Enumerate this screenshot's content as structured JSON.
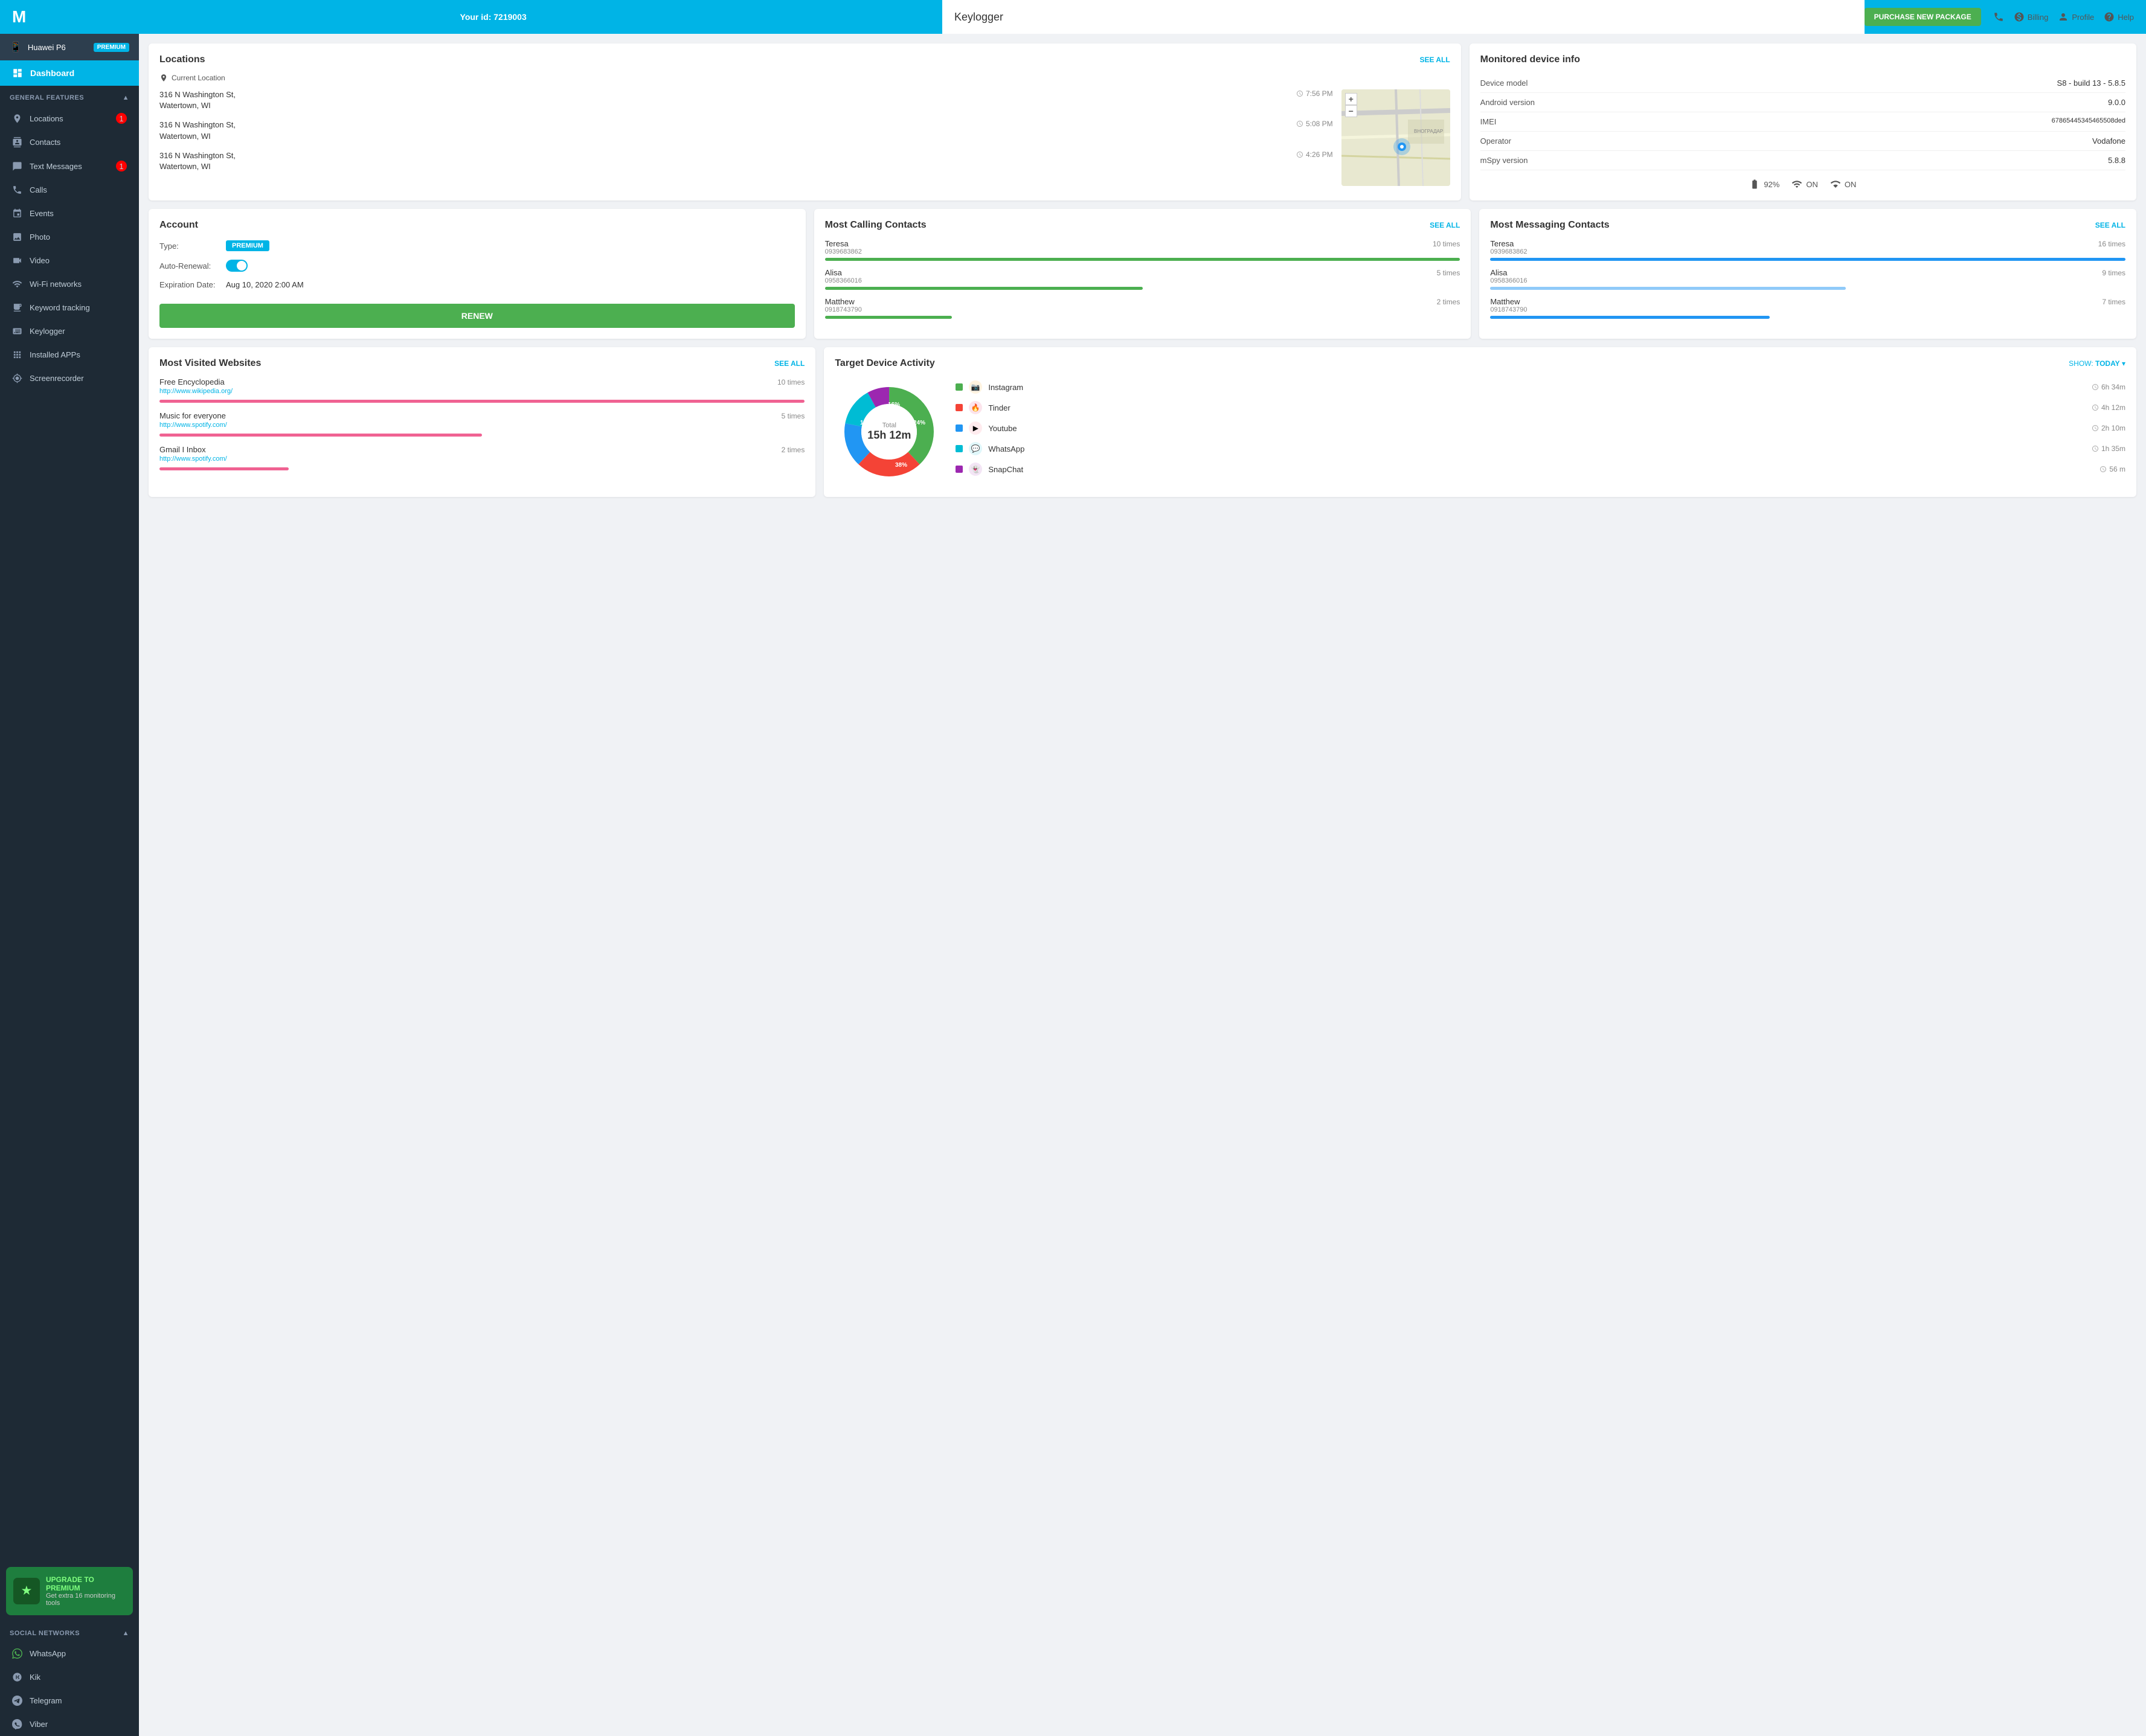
{
  "header": {
    "logo": "M",
    "user_id_label": "Your id: 7219003",
    "page_title": "Keylogger",
    "purchase_btn": "PURCHASE NEW PACKAGE",
    "nav_items": [
      {
        "icon": "phone",
        "label": ""
      },
      {
        "icon": "billing",
        "label": "Billing"
      },
      {
        "icon": "profile",
        "label": "Profile"
      },
      {
        "icon": "help",
        "label": "Help"
      }
    ]
  },
  "sidebar": {
    "device_name": "Huawei P6",
    "premium_badge": "PREMIUM",
    "active_item": "Dashboard",
    "general_features_label": "GENERAL FEATURES",
    "nav_items": [
      {
        "id": "locations",
        "label": "Locations",
        "badge": "1"
      },
      {
        "id": "contacts",
        "label": "Contacts",
        "badge": null
      },
      {
        "id": "text-messages",
        "label": "Text Messages",
        "badge": "1"
      },
      {
        "id": "calls",
        "label": "Calls",
        "badge": null
      },
      {
        "id": "events",
        "label": "Events",
        "badge": null
      },
      {
        "id": "photo",
        "label": "Photo",
        "badge": null
      },
      {
        "id": "video",
        "label": "Video",
        "badge": null
      },
      {
        "id": "wifi",
        "label": "Wi-Fi networks",
        "badge": null
      },
      {
        "id": "keyword",
        "label": "Keyword tracking",
        "badge": null
      },
      {
        "id": "keylogger",
        "label": "Keylogger",
        "badge": null
      },
      {
        "id": "installed-apps",
        "label": "Installed APPs",
        "badge": null
      },
      {
        "id": "screenrecorder",
        "label": "Screenrecorder",
        "badge": null
      }
    ],
    "upgrade": {
      "title": "UPGRADE TO PREMIUM",
      "subtitle": "Get extra 16 monitoring tools"
    },
    "social_networks_label": "SOCIAL NETWORKS",
    "social_items": [
      {
        "id": "whatsapp",
        "label": "WhatsApp"
      },
      {
        "id": "kik",
        "label": "Kik"
      },
      {
        "id": "telegram",
        "label": "Telegram"
      },
      {
        "id": "viber",
        "label": "Viber"
      }
    ]
  },
  "locations": {
    "title": "Locations",
    "see_all": "SEE ALL",
    "current_label": "Current Location",
    "entries": [
      {
        "address": "316 N Washington St,\nWatertown, WI",
        "time": "7:56 PM"
      },
      {
        "address": "316 N Washington St,\nWatertown, WI",
        "time": "5:08 PM"
      },
      {
        "address": "316 N Washington St,\nWatertown, WI",
        "time": "4:26 PM"
      }
    ],
    "map_plus": "+",
    "map_minus": "−"
  },
  "device_info": {
    "title": "Monitored device info",
    "rows": [
      {
        "label": "Device model",
        "value": "S8 - build 13 - 5.8.5"
      },
      {
        "label": "Android version",
        "value": "9.0.0"
      },
      {
        "label": "IMEI",
        "value": "67865445345465508ded"
      },
      {
        "label": "Operator",
        "value": "Vodafone"
      },
      {
        "label": "mSpy version",
        "value": "5.8.8"
      }
    ],
    "battery": "92%",
    "wifi_label": "ON",
    "signal_label": "ON"
  },
  "account": {
    "title": "Account",
    "type_label": "Type:",
    "type_value": "PREMIUM",
    "renewal_label": "Auto-Renewal:",
    "expiry_label": "Expiration Date:",
    "expiry_value": "Aug 10, 2020 2:00 AM",
    "renew_btn": "RENEW"
  },
  "calling_contacts": {
    "title": "Most Calling Contacts",
    "see_all": "SEE ALL",
    "entries": [
      {
        "name": "Teresa",
        "phone": "0939683862",
        "times": "10 times",
        "bar_pct": 100,
        "color": "#4caf50"
      },
      {
        "name": "Alisa",
        "phone": "0958366016",
        "times": "5 times",
        "bar_pct": 50,
        "color": "#4caf50"
      },
      {
        "name": "Matthew",
        "phone": "0918743790",
        "times": "2 times",
        "bar_pct": 20,
        "color": "#4caf50"
      }
    ]
  },
  "messaging_contacts": {
    "title": "Most Messaging Contacts",
    "see_all": "SEE ALL",
    "entries": [
      {
        "name": "Teresa",
        "phone": "0939683862",
        "times": "16 times",
        "bar_pct": 100,
        "color": "#2196F3"
      },
      {
        "name": "Alisa",
        "phone": "0958366016",
        "times": "9 times",
        "bar_pct": 56,
        "color": "#90caf9"
      },
      {
        "name": "Matthew",
        "phone": "0918743790",
        "times": "7 times",
        "bar_pct": 44,
        "color": "#2196F3"
      }
    ]
  },
  "websites": {
    "title": "Most Visited Websites",
    "see_all": "SEE ALL",
    "entries": [
      {
        "name": "Free Encyclopedia",
        "url": "http://www.wikipedia.org/",
        "times": "10 times",
        "bar_pct": 100,
        "color": "#f06292"
      },
      {
        "name": "Music for everyone",
        "url": "http://www.spotify.com/",
        "times": "5 times",
        "bar_pct": 50,
        "color": "#f06292"
      },
      {
        "name": "Gmail I Inbox",
        "url": "http://www.spotify.com/",
        "times": "2 times",
        "bar_pct": 20,
        "color": "#f06292"
      }
    ]
  },
  "activity": {
    "title": "Target Device Activity",
    "show_label": "SHOW:",
    "show_value": "TODAY",
    "total_label": "Total",
    "total_value": "15h 12m",
    "donut_segments": [
      {
        "label": "Instagram",
        "pct": 38,
        "color": "#4caf50",
        "start": 0
      },
      {
        "label": "Tinder",
        "pct": 24,
        "color": "#f44336",
        "start": 38
      },
      {
        "label": "Youtube",
        "pct": 16,
        "color": "#2196F3",
        "start": 62
      },
      {
        "label": "WhatsApp",
        "pct": 14,
        "color": "#00bcd4",
        "start": 78
      },
      {
        "label": "SnapChat",
        "pct": 8,
        "color": "#9c27b0",
        "start": 92
      }
    ],
    "legend": [
      {
        "app": "Instagram",
        "time": "6h 34m",
        "color": "#4caf50",
        "icon_bg": "#fff3e0",
        "icon": "📷"
      },
      {
        "app": "Tinder",
        "time": "4h 12m",
        "color": "#f44336",
        "icon_bg": "#fce4ec",
        "icon": "🔥"
      },
      {
        "app": "Youtube",
        "time": "2h 10m",
        "color": "#2196F3",
        "icon_bg": "#ffebee",
        "icon": "▶"
      },
      {
        "app": "WhatsApp",
        "time": "1h 35m",
        "color": "#00bcd4",
        "icon_bg": "#e0f7fa",
        "icon": "💬"
      },
      {
        "app": "SnapChat",
        "time": "56 m",
        "color": "#9c27b0",
        "icon_bg": "#f3e5f5",
        "icon": "👻"
      }
    ]
  }
}
